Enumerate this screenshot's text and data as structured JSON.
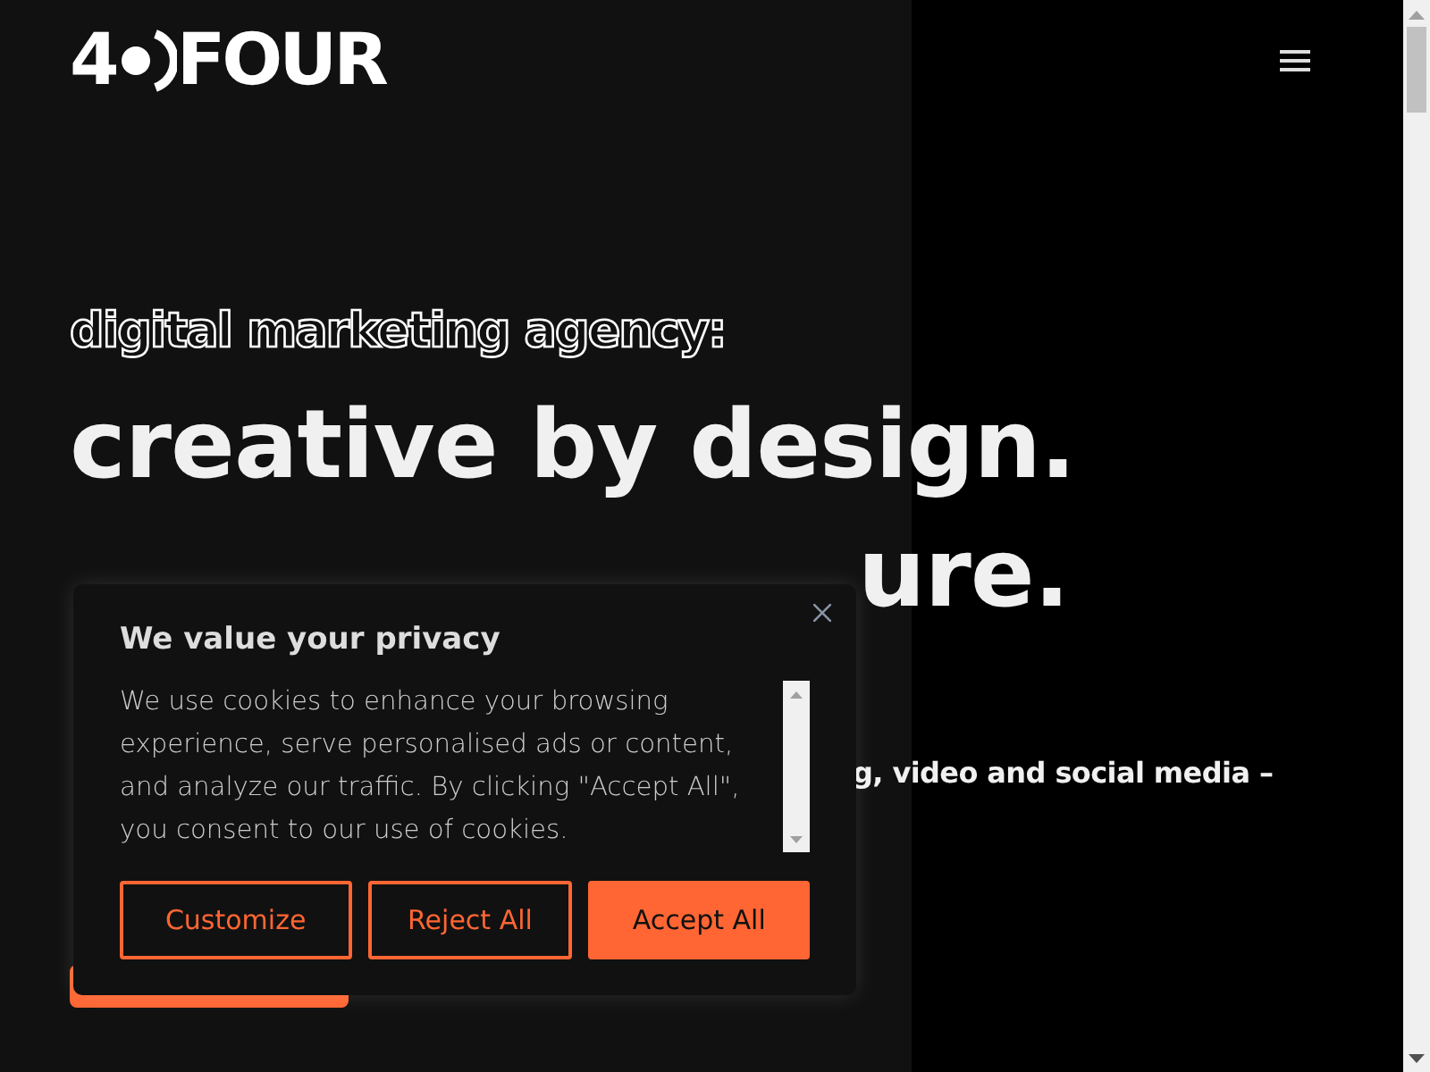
{
  "header": {
    "logo": {
      "numeral": "4",
      "word": "FOUR"
    }
  },
  "hero": {
    "eyebrow": "digital marketing agency:",
    "headlines": [
      "creative by design.",
      "ure."
    ],
    "intro_fragment": "g, video and social media –"
  },
  "cookie_banner": {
    "title": "We value your privacy",
    "body": "We use cookies to enhance your browsing experience, serve personalised ads or content, and analyze our traffic. By clicking \"Accept All\", you consent to our use of cookies.",
    "buttons": [
      {
        "label": "Customize",
        "kind": "outline"
      },
      {
        "label": "Reject All",
        "kind": "outline"
      },
      {
        "label": "Accept All",
        "kind": "filled"
      }
    ]
  }
}
